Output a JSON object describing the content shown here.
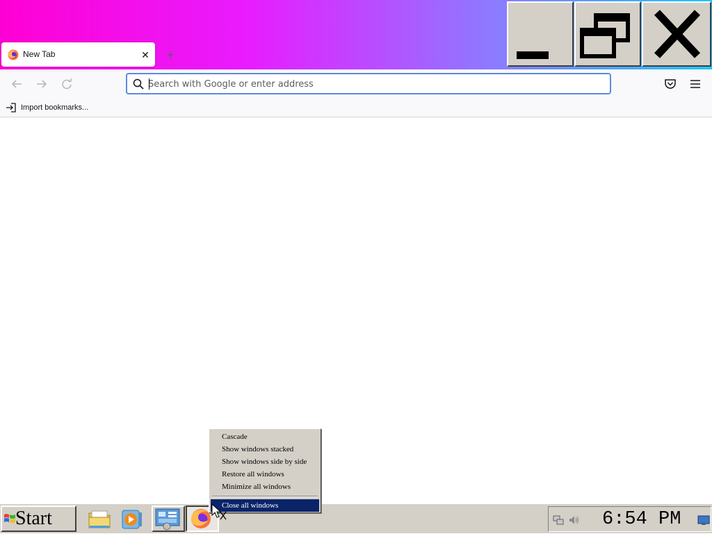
{
  "browser": {
    "tab": {
      "title": "New Tab",
      "close_icon": "close-icon",
      "favicon": "firefox-icon"
    },
    "new_tab_icon": "plus-icon",
    "window_controls": {
      "minimize": "minimize-icon",
      "maximize": "restore-icon",
      "close": "close-icon"
    },
    "nav": {
      "back": "arrow-left-icon",
      "forward": "arrow-right-icon",
      "reload": "reload-icon"
    },
    "urlbar": {
      "placeholder": "Search with Google or enter address",
      "value": ""
    },
    "toolbar_right": {
      "pocket": "pocket-icon",
      "menu": "hamburger-menu-icon"
    },
    "bookmarks": {
      "import_label": "Import bookmarks..."
    }
  },
  "context_menu": {
    "items": [
      {
        "label": "Cascade"
      },
      {
        "label": "Show windows stacked"
      },
      {
        "label": "Show windows side by side"
      },
      {
        "label": "Restore all windows"
      },
      {
        "label": "Minimize all windows"
      },
      {
        "label": "Close all windows",
        "selected": true
      }
    ]
  },
  "taskbar": {
    "start_label": "Start",
    "quick_launch": [
      "file-explorer-icon",
      "media-player-icon"
    ],
    "tasks": [
      "control-panel-icon",
      "firefox-icon"
    ],
    "clock": "6:54 PM",
    "tray": [
      "network-icon",
      "volume-icon",
      "show-desktop-icon"
    ]
  },
  "colors": {
    "titlebar_gradient": [
      "#ff00d4",
      "#e81cff",
      "#8a7dff",
      "#1ec8ff"
    ],
    "menu_highlight": "#0a246a",
    "urlbar_focus": "#5a8be0",
    "classic_face": "#d4d0c8"
  }
}
